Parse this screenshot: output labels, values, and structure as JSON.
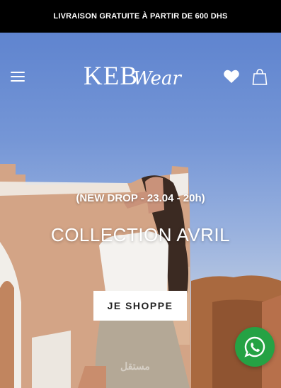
{
  "announcement": {
    "text": "LIVRAISON GRATUITE À PARTIR DE 600 DHS"
  },
  "header": {
    "logo_main": "KEB",
    "logo_script": "Wear",
    "icons": [
      "menu-icon",
      "heart-icon",
      "shopping-bag-icon"
    ]
  },
  "hero": {
    "drop_text": "(NEW DROP - 23.04 - 20h)",
    "title": "COLLECTION AVRIL",
    "cta_label": "JE SHOPPE",
    "watermark": "مستقل"
  },
  "floating": {
    "icon": "whatsapp-icon",
    "color": "#25a244"
  },
  "colors": {
    "announcement_bg": "#000000",
    "announcement_text": "#ffffff",
    "cta_bg": "#ffffff",
    "cta_text": "#222222"
  }
}
